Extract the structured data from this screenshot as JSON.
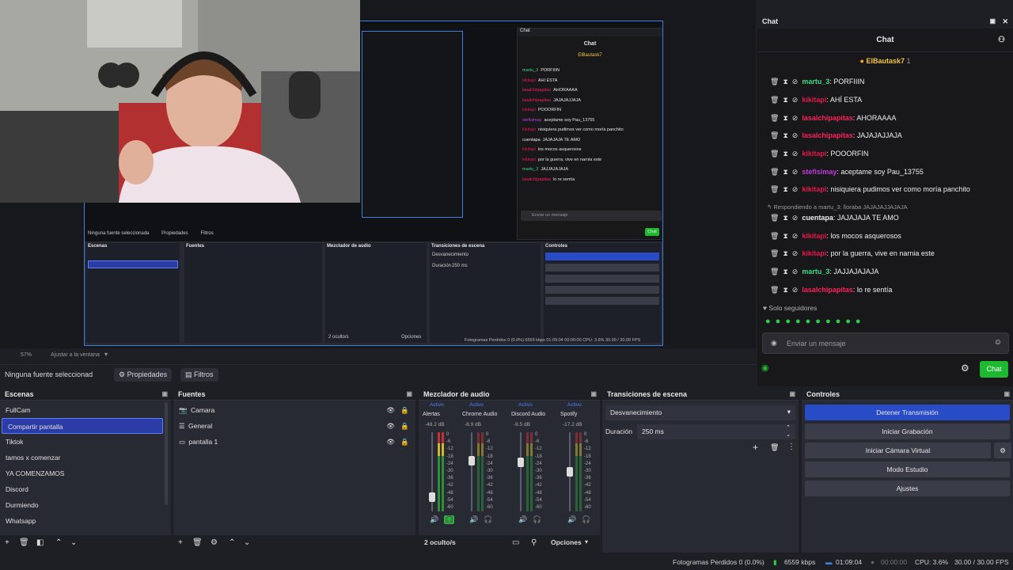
{
  "preview": {
    "inner": {
      "chat_title": "Chat",
      "chat_name": "Chat",
      "streamer": "ElBautask7",
      "send_label": "Chat",
      "placeholder": "Enviar un mensaje",
      "followers": "Solo seguidores",
      "no_source": "Ninguna fuente seleccionada",
      "props": "Propiedades",
      "filters": "Filtros",
      "zoom": "57%",
      "fit": "Ajustar a la ventana",
      "docks": [
        "Escenas",
        "Fuentes",
        "Mezclador de audio",
        "Transiciones de escena",
        "Controles"
      ],
      "fade": "Desvanecimiento",
      "duration_label": "Duración",
      "duration": "250 ms",
      "hidden": "2 oculto/s",
      "options": "Opciones",
      "status": "Fotogramas Perdidos 0 (0.0%)   6559 kbps   01:09:04   00:00:00   CPU: 3.6%   30.00 / 30.00 FPS"
    }
  },
  "zoombar": {
    "zoom": "57%",
    "fit": "Ajustar a la ventana"
  },
  "propsbar": {
    "no_source": "Ninguna fuente seleccionad",
    "properties": "Propiedades",
    "filters": "Filtros"
  },
  "scenes": {
    "title": "Escenas",
    "items": [
      "FullCam",
      "Compartir pantalla",
      "Tiktok",
      "tamos x comenzar",
      "YA COMENZAMOS",
      "Discord",
      "Durmiendo",
      "Whatsapp"
    ]
  },
  "sources": {
    "title": "Fuentes",
    "items": [
      {
        "label": "Camara",
        "icon": "camera-icon"
      },
      {
        "label": "General",
        "icon": "list-icon"
      },
      {
        "label": "pantalla 1",
        "icon": "monitor-icon"
      }
    ]
  },
  "mixer": {
    "title": "Mezclador de audio",
    "channels": [
      {
        "active": "Activo",
        "name": "Alertas",
        "db": "-48.2 dB"
      },
      {
        "active": "Activo",
        "name": "Chrome Audio",
        "db": "-8.9 dB"
      },
      {
        "active": "Activo",
        "name": "Discord Audio",
        "db": "-9.5 dB"
      },
      {
        "active": "Activo",
        "name": "Spotify",
        "db": "-17.2 dB"
      }
    ],
    "scale": [
      "0",
      "-6",
      "-12",
      "-18",
      "-24",
      "-30",
      "-36",
      "-42",
      "-48",
      "-54",
      "-60"
    ],
    "hidden": "2 oculto/s",
    "options": "Opciones"
  },
  "transitions": {
    "title": "Transiciones de escena",
    "selected": "Desvanecimiento",
    "duration_label": "Duración",
    "duration": "250 ms"
  },
  "controls": {
    "title": "Controles",
    "buttons": [
      "Detener Transmisión",
      "Iniciar Grabación",
      "Iniciar Cámara Virtual",
      "Modo Estudio",
      "Ajustes"
    ]
  },
  "chat": {
    "title": "Chat",
    "header": "Chat",
    "streamer": "ElBautask7",
    "streamer_count": "1",
    "reply": "Respondiendo a martu_3: lloraba JAJAJAJJAJAJA",
    "messages": [
      {
        "user": "martu_3",
        "text": "PORFIIIN",
        "color": "#3ddc84"
      },
      {
        "user": "kikitapi",
        "text": "AHÍ ESTA",
        "color": "#e5174a"
      },
      {
        "user": "lasalchipapitas",
        "text": "AHORAAAA",
        "color": "#ff1f5a"
      },
      {
        "user": "lasalchipapitas",
        "text": "JAJAJAJJAJA",
        "color": "#ff1f5a"
      },
      {
        "user": "kikitapi",
        "text": "POOORFIN",
        "color": "#e5174a"
      },
      {
        "user": "stefisimay",
        "text": "aceptame soy Pau_13755",
        "color": "#c13ddc"
      },
      {
        "user": "kikitapi",
        "text": "nisiquiera pudimos ver como moría panchito",
        "color": "#e5174a"
      },
      {
        "user": "cuentapa",
        "text": "JAJAJAJA TE AMO",
        "color": "#efeff1"
      },
      {
        "user": "kikitapi",
        "text": "los mocos asquerosos",
        "color": "#e5174a"
      },
      {
        "user": "kikitapi",
        "text": "por la guerra, vive en narnia este",
        "color": "#e5174a"
      },
      {
        "user": "martu_3",
        "text": "JAJJAJAJAJA",
        "color": "#3ddc84"
      },
      {
        "user": "lasalchipapitas",
        "text": "lo re sentía",
        "color": "#ff1f5a"
      }
    ],
    "followers_only": "Solo seguidores",
    "placeholder": "Enviar un mensaje",
    "send": "Chat"
  },
  "status": {
    "dropped": "Fotogramas Perdidos 0 (0.0%)",
    "kbps": "6559 kbps",
    "live_time": "01:09:04",
    "rec_time": "00:00:00",
    "cpu": "CPU: 3.6%",
    "fps": "30.00 / 30.00 FPS"
  },
  "colors": {
    "accent_blue": "#284cc8",
    "chat_green": "#1fb831",
    "selection": "#2c3ca6"
  }
}
